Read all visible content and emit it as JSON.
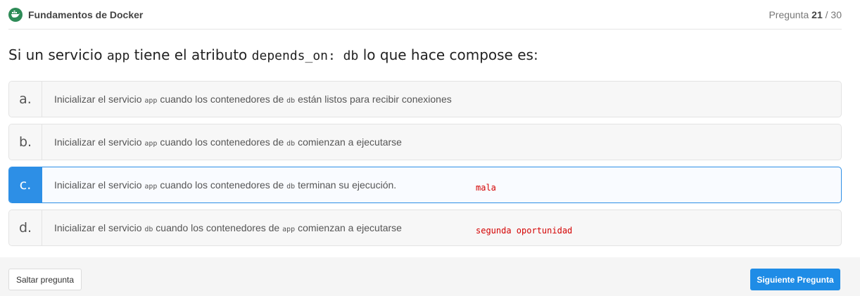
{
  "header": {
    "logo_icon": "docker-logo-icon",
    "course_title": "Fundamentos de Docker",
    "counter_prefix": "Pregunta",
    "current": "21",
    "total_sep": " / 30"
  },
  "question": {
    "p1": "Si un servicio ",
    "c1": "app",
    "p2": " tiene el atributo ",
    "c2": "depends_on: db",
    "p3": " lo que hace compose es:"
  },
  "options": [
    {
      "letter": "a.",
      "t1": "Inicializar el servicio ",
      "c1": "app",
      "t2": " cuando los contenedores de ",
      "c2": "db",
      "t3": " están listos para recibir conexiones"
    },
    {
      "letter": "b.",
      "t1": "Inicializar el servicio ",
      "c1": "app",
      "t2": " cuando los contenedores de ",
      "c2": "db",
      "t3": " comienzan a ejecutarse"
    },
    {
      "letter": "c.",
      "t1": "Inicializar el servicio ",
      "c1": "app",
      "t2": " cuando los contenedores de ",
      "c2": "db",
      "t3": " terminan su ejecución.",
      "note": "mala"
    },
    {
      "letter": "d.",
      "t1": "Inicializar el servicio ",
      "c1": "db",
      "t2": " cuando los contenedores de ",
      "c2": "app",
      "t3": " comienzan a ejecutarse",
      "note": "segunda oportunidad"
    }
  ],
  "selected_option": "c.",
  "colors": {
    "accent": "#2d8fe6",
    "note": "#d40000"
  },
  "footer": {
    "skip_label": "Saltar pregunta",
    "next_label": "Siguiente Pregunta"
  }
}
